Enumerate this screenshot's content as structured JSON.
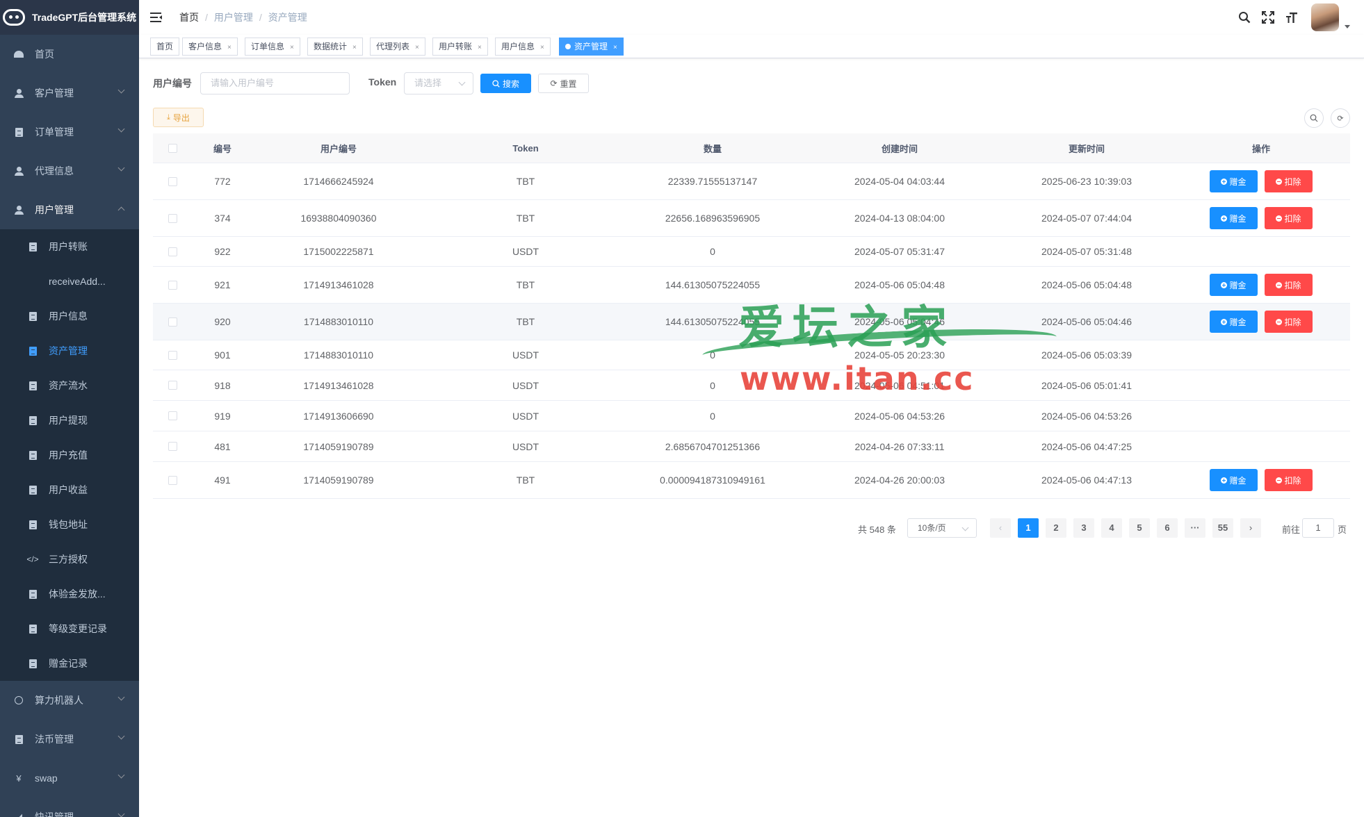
{
  "app": {
    "title": "TradeGPT后台管理系统"
  },
  "sidebar": {
    "items": [
      {
        "label": "首页"
      },
      {
        "label": "客户管理"
      },
      {
        "label": "订单管理"
      },
      {
        "label": "代理信息"
      },
      {
        "label": "用户管理"
      }
    ],
    "submenu": [
      {
        "label": "用户转账"
      },
      {
        "label": "receiveAdd..."
      },
      {
        "label": "用户信息"
      },
      {
        "label": "资产管理"
      },
      {
        "label": "资产流水"
      },
      {
        "label": "用户提现"
      },
      {
        "label": "用户充值"
      },
      {
        "label": "用户收益"
      },
      {
        "label": "钱包地址"
      },
      {
        "label": "三方授权"
      },
      {
        "label": "体验金发放..."
      },
      {
        "label": "等级变更记录"
      },
      {
        "label": "赠金记录"
      }
    ],
    "bottom_items": [
      {
        "label": "算力机器人"
      },
      {
        "label": "法币管理"
      },
      {
        "label": "swap"
      },
      {
        "label": "快讯管理"
      }
    ]
  },
  "breadcrumb": {
    "home": "首页",
    "sep": "/",
    "level1": "用户管理",
    "level2": "资产管理"
  },
  "tags": [
    {
      "label": "首页"
    },
    {
      "label": "客户信息"
    },
    {
      "label": "订单信息"
    },
    {
      "label": "数据统计"
    },
    {
      "label": "代理列表"
    },
    {
      "label": "用户转账"
    },
    {
      "label": "用户信息"
    },
    {
      "label": "资产管理"
    }
  ],
  "tag_close": "×",
  "search": {
    "user_label": "用户编号",
    "user_placeholder": "请输入用户编号",
    "token_label": "Token",
    "token_placeholder": "请选择",
    "search_button": "搜索",
    "reset_button": "重置"
  },
  "toolbar": {
    "export_button": "导出"
  },
  "table": {
    "headers": [
      "编号",
      "用户编号",
      "Token",
      "数量",
      "创建时间",
      "更新时间",
      "操作"
    ],
    "actions": {
      "gift": "赠金",
      "deduct": "扣除"
    },
    "rows": [
      {
        "id": "772",
        "user": "1714666245924",
        "token": "TBT",
        "amount": "22339.71555137147",
        "created": "2024-05-04 04:03:44",
        "updated": "2025-06-23 10:39:03",
        "ops": true
      },
      {
        "id": "374",
        "user": "16938804090360",
        "token": "TBT",
        "amount": "22656.168963596905",
        "created": "2024-04-13 08:04:00",
        "updated": "2024-05-07 07:44:04",
        "ops": true
      },
      {
        "id": "922",
        "user": "1715002225871",
        "token": "USDT",
        "amount": "0",
        "created": "2024-05-07 05:31:47",
        "updated": "2024-05-07 05:31:48",
        "ops": false
      },
      {
        "id": "921",
        "user": "1714913461028",
        "token": "TBT",
        "amount": "144.61305075224055",
        "created": "2024-05-06 05:04:48",
        "updated": "2024-05-06 05:04:48",
        "ops": true
      },
      {
        "id": "920",
        "user": "1714883010110",
        "token": "TBT",
        "amount": "144.61305075224055",
        "created": "2024-05-06 05:04:46",
        "updated": "2024-05-06 05:04:46",
        "ops": true
      },
      {
        "id": "901",
        "user": "1714883010110",
        "token": "USDT",
        "amount": "0",
        "created": "2024-05-05 20:23:30",
        "updated": "2024-05-06 05:03:39",
        "ops": false
      },
      {
        "id": "918",
        "user": "1714913461028",
        "token": "USDT",
        "amount": "0",
        "created": "2024-05-06 04:51:01",
        "updated": "2024-05-06 05:01:41",
        "ops": false
      },
      {
        "id": "919",
        "user": "1714913606690",
        "token": "USDT",
        "amount": "0",
        "created": "2024-05-06 04:53:26",
        "updated": "2024-05-06 04:53:26",
        "ops": false
      },
      {
        "id": "481",
        "user": "1714059190789",
        "token": "USDT",
        "amount": "2.6856704701251366",
        "created": "2024-04-26 07:33:11",
        "updated": "2024-05-06 04:47:25",
        "ops": false
      },
      {
        "id": "491",
        "user": "1714059190789",
        "token": "TBT",
        "amount": "0.000094187310949161",
        "created": "2024-04-26 20:00:03",
        "updated": "2024-05-06 04:47:13",
        "ops": true
      }
    ]
  },
  "pagination": {
    "total": "共 548 条",
    "page_size": "10条/页",
    "pages": [
      "1",
      "2",
      "3",
      "4",
      "5",
      "6",
      "···",
      "55"
    ],
    "current": "1",
    "goto_label": "前往",
    "goto_value": "1",
    "goto_unit": "页"
  },
  "watermark": {
    "logo_text": "爱坛之家",
    "url": "www.itan.cc"
  },
  "colors": {
    "sidebar_bg": "#304156",
    "primary": "#1890ff",
    "danger": "#ff4949",
    "warning": "#e6a23c",
    "active_menu": "#409eff"
  }
}
